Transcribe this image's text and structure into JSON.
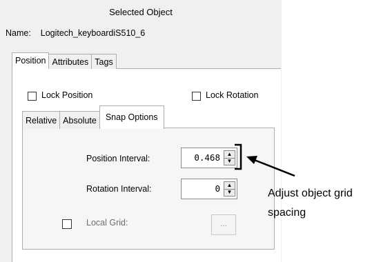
{
  "panel": {
    "title": "Selected Object",
    "name_label": "Name:",
    "name_value": "Logitech_keyboardiS510_6"
  },
  "tabs": [
    "Position",
    "Attributes",
    "Tags"
  ],
  "lock": {
    "position_label": "Lock Position",
    "position_checked": false,
    "rotation_label": "Lock Rotation",
    "rotation_checked": false
  },
  "subtabs": [
    "Relative",
    "Absolute",
    "Snap Options"
  ],
  "snap": {
    "position_label": "Position Interval:",
    "position_value": "0.468",
    "rotation_label": "Rotation Interval:",
    "rotation_value": "0",
    "local_grid_label": "Local Grid:",
    "local_grid_checked": false,
    "browse_label": "..."
  },
  "annotation": {
    "text_line1": "Adjust object grid",
    "text_line2": "spacing"
  }
}
